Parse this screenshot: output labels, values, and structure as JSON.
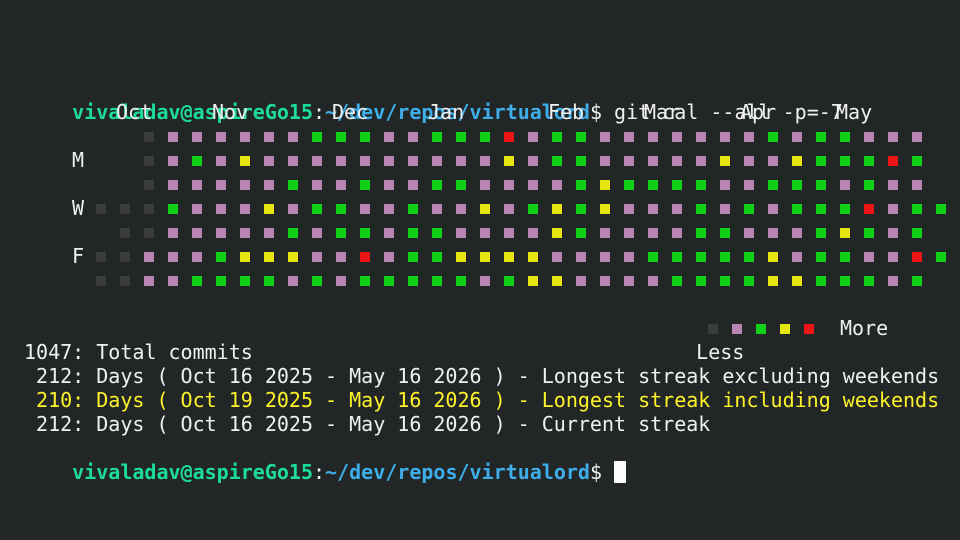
{
  "prompt": {
    "user_host": "vivaladav@aspireGo15",
    "sep": ":",
    "path": "~/dev/repos/virtualord",
    "dollar": "$",
    "command": " git cal --all -p=-7"
  },
  "calendar": {
    "months": [
      {
        "label": "Oct",
        "col": 1
      },
      {
        "label": "Nov",
        "col": 5
      },
      {
        "label": "Dec",
        "col": 10
      },
      {
        "label": "Jan",
        "col": 14
      },
      {
        "label": "Feb",
        "col": 19
      },
      {
        "label": "Mar",
        "col": 23
      },
      {
        "label": "Apr",
        "col": 27
      },
      {
        "label": "May",
        "col": 31
      }
    ],
    "day_labels": [
      {
        "label": "M",
        "row": 1
      },
      {
        "label": "W",
        "row": 3
      },
      {
        "label": "F",
        "row": 5
      }
    ],
    "grid": [
      "xx011111122211222412211111112122111",
      "xx012131111111111312211111311322242",
      "xx011111211211221111232222112221211",
      "000211131221121131232311121212224122",
      "x0011111212212211113211112211123212",
      "0011123331141223333111122222312211421",
      "00112222121222221233111122223322212"
    ]
  },
  "legend": {
    "less": "Less",
    "more": "More",
    "levels": [
      0,
      1,
      2,
      3,
      4
    ]
  },
  "stats": {
    "total": "1047: Total commits",
    "longest_excl": " 212: Days ( Oct 16 2025 - May 16 2026 ) - Longest streak excluding weekends",
    "longest_incl": " 210: Days ( Oct 19 2025 - May 16 2026 ) - Longest streak including weekends",
    "current": " 212: Days ( Oct 16 2025 - May 16 2026 ) - Current streak"
  },
  "prompt2": {
    "user_host": "vivaladav@aspireGo15",
    "sep": ":",
    "path": "~/dev/repos/virtualord",
    "dollar": "$"
  }
}
